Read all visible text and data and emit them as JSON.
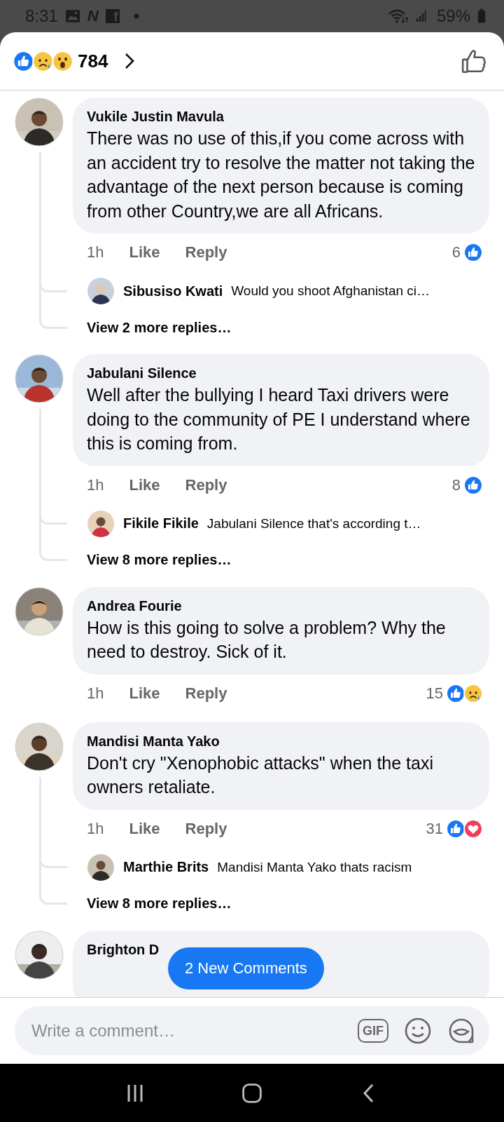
{
  "status_bar": {
    "time": "8:31",
    "notification_icons": [
      "N",
      "f"
    ],
    "battery": "59%"
  },
  "header": {
    "reactions": [
      {
        "kind": "like"
      },
      {
        "kind": "sad"
      },
      {
        "kind": "wow"
      }
    ],
    "count": "784"
  },
  "comments": [
    {
      "author": "Vukile Justin Mavula",
      "text": "There was no use of this,if you come across with an accident try to resolve the matter not taking the advantage of the next person because is coming from other Country,we are all Africans.",
      "time": "1h",
      "actions": [
        "Like",
        "Reply"
      ],
      "reaction_count": "6",
      "reactions": [
        {
          "kind": "like"
        }
      ],
      "replies": [
        {
          "author": "Sibusiso Kwati",
          "text": "Would you shoot Afghanistan ci…"
        }
      ],
      "more_replies": "View 2 more replies…"
    },
    {
      "author": "Jabulani Silence",
      "text": "Well after the bullying I heard Taxi drivers were doing to the community of PE I understand where this is coming from.",
      "time": "1h",
      "actions": [
        "Like",
        "Reply"
      ],
      "reaction_count": "8",
      "reactions": [
        {
          "kind": "like"
        }
      ],
      "replies": [
        {
          "author": "Fikile Fikile",
          "text": "Jabulani Silence that's according t…"
        }
      ],
      "more_replies": "View 8 more replies…"
    },
    {
      "author": "Andrea Fourie",
      "text": "How is this going to solve a problem?  Why the need to destroy.  Sick of it.",
      "time": "1h",
      "actions": [
        "Like",
        "Reply"
      ],
      "reaction_count": "15",
      "reactions": [
        {
          "kind": "like"
        },
        {
          "kind": "sad"
        }
      ]
    },
    {
      "author": "Mandisi Manta Yako",
      "text": "Don't cry \"Xenophobic attacks\" when the taxi owners retaliate.",
      "time": "1h",
      "actions": [
        "Like",
        "Reply"
      ],
      "reaction_count": "31",
      "reactions": [
        {
          "kind": "like"
        },
        {
          "kind": "love"
        }
      ],
      "replies": [
        {
          "author": "Marthie Brits",
          "text": "Mandisi Manta Yako thats racism"
        }
      ],
      "more_replies": "View 8 more replies…"
    },
    {
      "author": "Brighton D"
    }
  ],
  "new_comments_button": "2 New Comments",
  "composer": {
    "placeholder": "Write a comment…",
    "gif": "GIF"
  }
}
